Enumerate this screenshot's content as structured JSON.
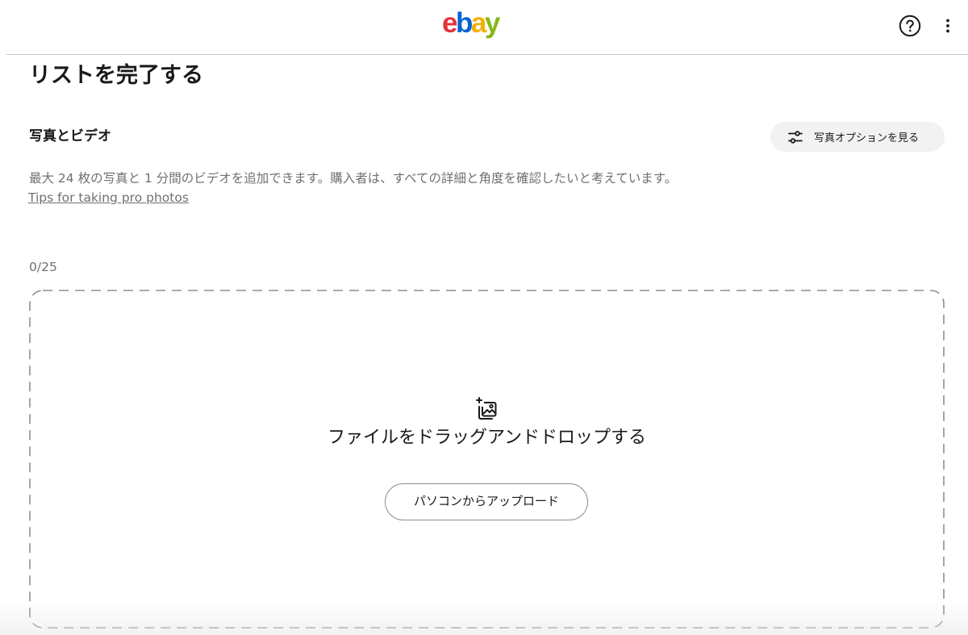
{
  "header": {
    "logo": {
      "e": "e",
      "b": "b",
      "a": "a",
      "y": "y"
    },
    "help_icon": "question-circle-icon",
    "more_icon": "vertical-ellipsis-icon"
  },
  "page": {
    "title": "リストを完了する"
  },
  "photos_section": {
    "title": "写真とビデオ",
    "options_button": {
      "icon": "sliders-icon",
      "label": "写真オプションを見る"
    },
    "description": "最大 24 枚の写真と 1 分間のビデオを追加できます。購入者は、すべての詳細と角度を確認したいと考えています。",
    "tips_link": "Tips for taking pro photos",
    "counter": "0/25",
    "dropzone": {
      "icon": "add-image-icon",
      "text": "ファイルをドラッグアンドドロップする",
      "upload_button": "パソコンからアップロード"
    }
  },
  "colors": {
    "logo_e": "#e53238",
    "logo_b": "#0064d2",
    "logo_a": "#f5af02",
    "logo_y": "#86b817",
    "text": "#191919",
    "muted_text": "#707070",
    "options_button_bg": "#f2f2f2"
  }
}
